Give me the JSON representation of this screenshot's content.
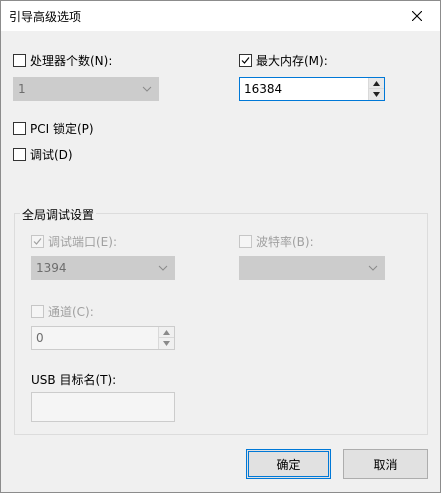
{
  "window": {
    "title": "引导高级选项"
  },
  "left": {
    "processors": {
      "label": "处理器个数(N):",
      "checked": false,
      "value": "1"
    },
    "pci_lock": {
      "label": "PCI 锁定(P)",
      "checked": false
    },
    "debug": {
      "label": "调试(D)",
      "checked": false
    }
  },
  "right": {
    "max_memory": {
      "label": "最大内存(M):",
      "checked": true,
      "value": "16384"
    }
  },
  "debug_settings": {
    "title": "全局调试设置",
    "debug_port": {
      "label": "调试端口(E):",
      "checked": true,
      "value": "1394"
    },
    "baud_rate": {
      "label": "波特率(B):",
      "checked": false,
      "value": ""
    },
    "channel": {
      "label": "通道(C):",
      "checked": false,
      "value": "0"
    },
    "usb_target": {
      "label": "USB 目标名(T):",
      "value": ""
    }
  },
  "buttons": {
    "ok": "确定",
    "cancel": "取消"
  },
  "colors": {
    "accent": "#0078d7",
    "window_bg": "#f0f0f0",
    "disabled_text": "#a0a0a0"
  }
}
